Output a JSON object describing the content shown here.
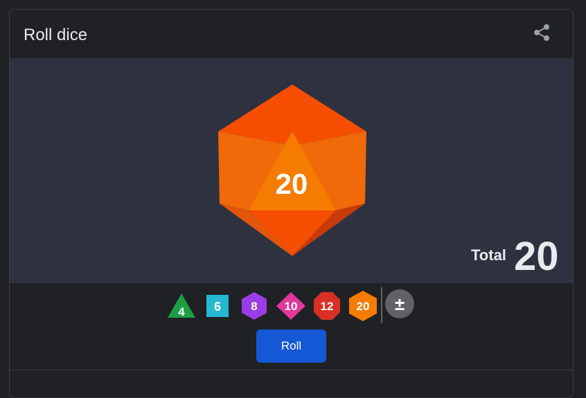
{
  "header": {
    "title": "Roll dice",
    "share_icon": "share-icon"
  },
  "die": {
    "type": "d20",
    "value": "20",
    "colors": {
      "top": "#f54e00",
      "face": "#f57c00",
      "side": "#f06a0a",
      "dark": "#c93a0a"
    }
  },
  "total": {
    "label": "Total",
    "value": "20"
  },
  "dice_options": [
    {
      "label": "4",
      "shape": "triangle",
      "color": "#1e9e45"
    },
    {
      "label": "6",
      "shape": "square",
      "color": "#24b8d1"
    },
    {
      "label": "8",
      "shape": "hexagon",
      "color": "#9b3de6"
    },
    {
      "label": "10",
      "shape": "diamond",
      "color": "#e0389b"
    },
    {
      "label": "12",
      "shape": "octagon",
      "color": "#d93025"
    },
    {
      "label": "20",
      "shape": "hexagon",
      "color": "#f57c00"
    }
  ],
  "modifier": {
    "label": "±"
  },
  "roll_button": {
    "label": "Roll",
    "color": "#1558d6"
  }
}
